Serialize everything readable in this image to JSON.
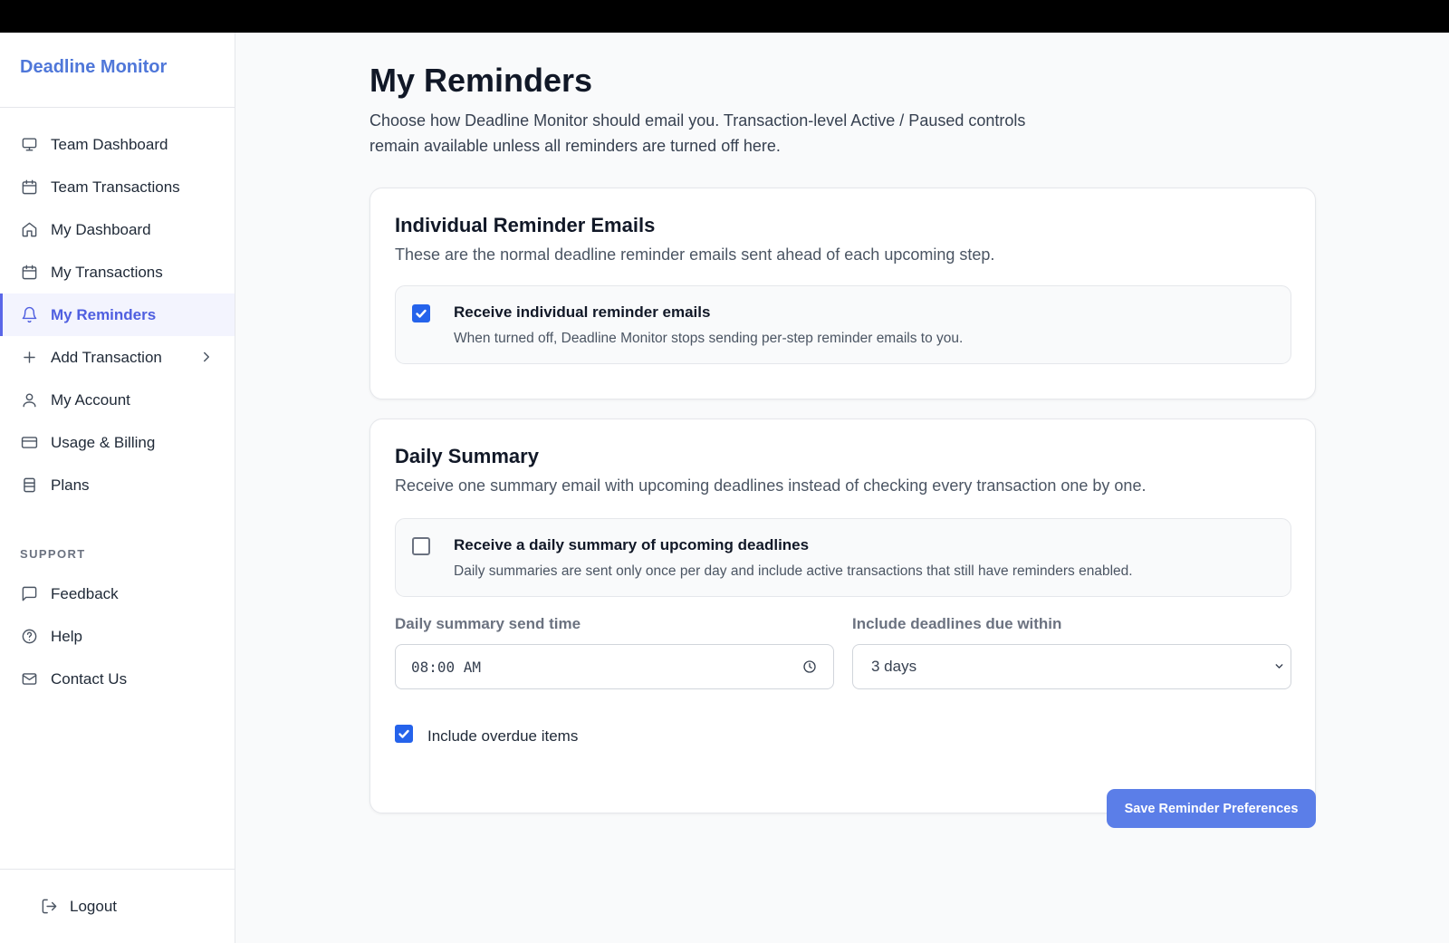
{
  "app": {
    "brand": "Deadline Monitor"
  },
  "sidebar": {
    "items": [
      {
        "label": "Team Dashboard",
        "icon": "monitor-icon",
        "active": false
      },
      {
        "label": "Team Transactions",
        "icon": "calendar-icon",
        "active": false
      },
      {
        "label": "My Dashboard",
        "icon": "home-icon",
        "active": false
      },
      {
        "label": "My Transactions",
        "icon": "calendar-icon",
        "active": false
      },
      {
        "label": "My Reminders",
        "icon": "bell-icon",
        "active": true
      },
      {
        "label": "Add Transaction",
        "icon": "plus-icon",
        "active": false,
        "has_submenu": true
      },
      {
        "label": "My Account",
        "icon": "user-icon",
        "active": false
      },
      {
        "label": "Usage & Billing",
        "icon": "credit-card-icon",
        "active": false
      },
      {
        "label": "Plans",
        "icon": "stack-icon",
        "active": false
      }
    ],
    "support_label": "SUPPORT",
    "support_items": [
      {
        "label": "Feedback",
        "icon": "message-icon"
      },
      {
        "label": "Help",
        "icon": "help-circle-icon"
      },
      {
        "label": "Contact Us",
        "icon": "mail-icon"
      }
    ],
    "logout_label": "Logout"
  },
  "page": {
    "title": "My Reminders",
    "description": "Choose how Deadline Monitor should email you. Transaction-level Active / Paused controls remain available unless all reminders are turned off here."
  },
  "individual": {
    "title": "Individual Reminder Emails",
    "description": "These are the normal deadline reminder emails sent ahead of each upcoming step.",
    "option_title": "Receive individual reminder emails",
    "option_description": "When turned off, Deadline Monitor stops sending per-step reminder emails to you.",
    "checked": true
  },
  "daily": {
    "title": "Daily Summary",
    "description": "Receive one summary email with upcoming deadlines instead of checking every transaction one by one.",
    "option_title": "Receive a daily summary of upcoming deadlines",
    "option_description": "Daily summaries are sent only once per day and include active transactions that still have reminders enabled.",
    "checked": false,
    "time_label": "Daily summary send time",
    "time_value": "08:00 AM",
    "within_label": "Include deadlines due within",
    "within_value": "3 days",
    "overdue_label": "Include overdue items",
    "overdue_checked": true
  },
  "actions": {
    "save_label": "Save Reminder Preferences"
  },
  "colors": {
    "brand": "#4f77d9",
    "accent": "#5b7ee8",
    "active_nav": "#4f5fe0",
    "checkbox": "#2563eb"
  }
}
